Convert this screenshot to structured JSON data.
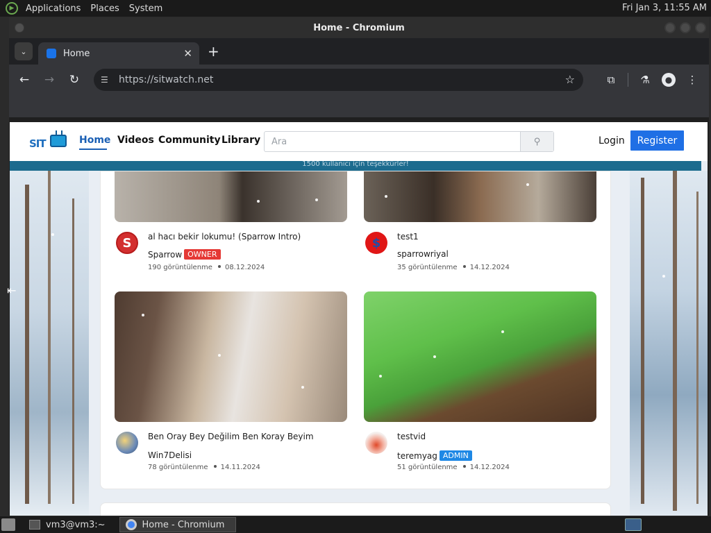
{
  "system_panel": {
    "menus": [
      "Applications",
      "Places",
      "System"
    ],
    "clock": "Fri Jan  3, 11:55 AM"
  },
  "window": {
    "title": "Home - Chromium"
  },
  "browser": {
    "tab_title": "Home",
    "tab_close": "✕",
    "new_tab": "+",
    "url": "https://sitwatch.net"
  },
  "site": {
    "logo_text": "SIT",
    "nav": [
      "Home",
      "Videos",
      "Community",
      "Library"
    ],
    "search_placeholder": "Ara",
    "login_label": "Login",
    "register_label": "Register",
    "announcement": "1500 kullanıcı için teşekkürler!"
  },
  "videos": [
    {
      "title": "al hacı bekir lokumu! (Sparrow Intro)",
      "channel": "Sparrow",
      "badge": "OWNER",
      "views": "190 görüntülenme",
      "date": "08.12.2024",
      "avatar_letter": "S"
    },
    {
      "title": "test1",
      "channel": "sparrowriyal",
      "badge": "",
      "views": "35 görüntülenme",
      "date": "14.12.2024",
      "avatar_letter": "$"
    },
    {
      "title": "Ben Oray Bey Değilim Ben Koray Beyim",
      "channel": "Win7Delisi",
      "badge": "",
      "views": "78 görüntülenme",
      "date": "14.11.2024",
      "avatar_letter": ""
    },
    {
      "title": "testvid",
      "channel": "teremyag",
      "badge": "ADMIN",
      "views": "51 görüntülenme",
      "date": "14.12.2024",
      "avatar_letter": ""
    }
  ],
  "taskbar": {
    "terminal_label": "vm3@vm3:~",
    "browser_label": "Home - Chromium"
  },
  "colors": {
    "accent": "#1f6fe5",
    "owner_badge": "#e53935",
    "admin_badge": "#1e88e5",
    "announce_bar": "#1c6b8e"
  }
}
